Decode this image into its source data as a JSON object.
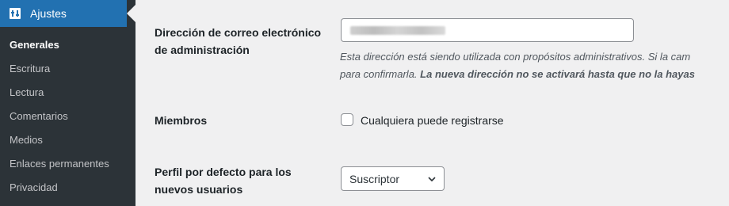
{
  "sidebar": {
    "section_label": "Ajustes",
    "items": [
      {
        "label": "Generales",
        "current": true
      },
      {
        "label": "Escritura"
      },
      {
        "label": "Lectura"
      },
      {
        "label": "Comentarios"
      },
      {
        "label": "Medios"
      },
      {
        "label": "Enlaces permanentes"
      },
      {
        "label": "Privacidad"
      }
    ]
  },
  "settings": {
    "admin_email": {
      "label_line1": "Dirección de correo electrónico",
      "label_line2": "de administración",
      "value": "",
      "description_line1": "Esta dirección está siendo utilizada con propósitos administrativos. Si la cam",
      "description_line2_prefix": "para confirmarla. ",
      "description_line2_bold": "La nueva dirección no se activará hasta que no la hayas"
    },
    "membership": {
      "label": "Miembros",
      "checkbox_label": "Cualquiera puede registrarse",
      "checked": false
    },
    "default_role": {
      "label_line1": "Perfil por defecto para los",
      "label_line2": "nuevos usuarios",
      "selected": "Suscriptor"
    }
  },
  "icons": {
    "section_icon": "settings-sliders-icon",
    "select_chevron": "chevron-down-icon"
  },
  "colors": {
    "sidebar_bg": "#2c3338",
    "accent": "#2271b1",
    "page_bg": "#f0f0f1"
  }
}
